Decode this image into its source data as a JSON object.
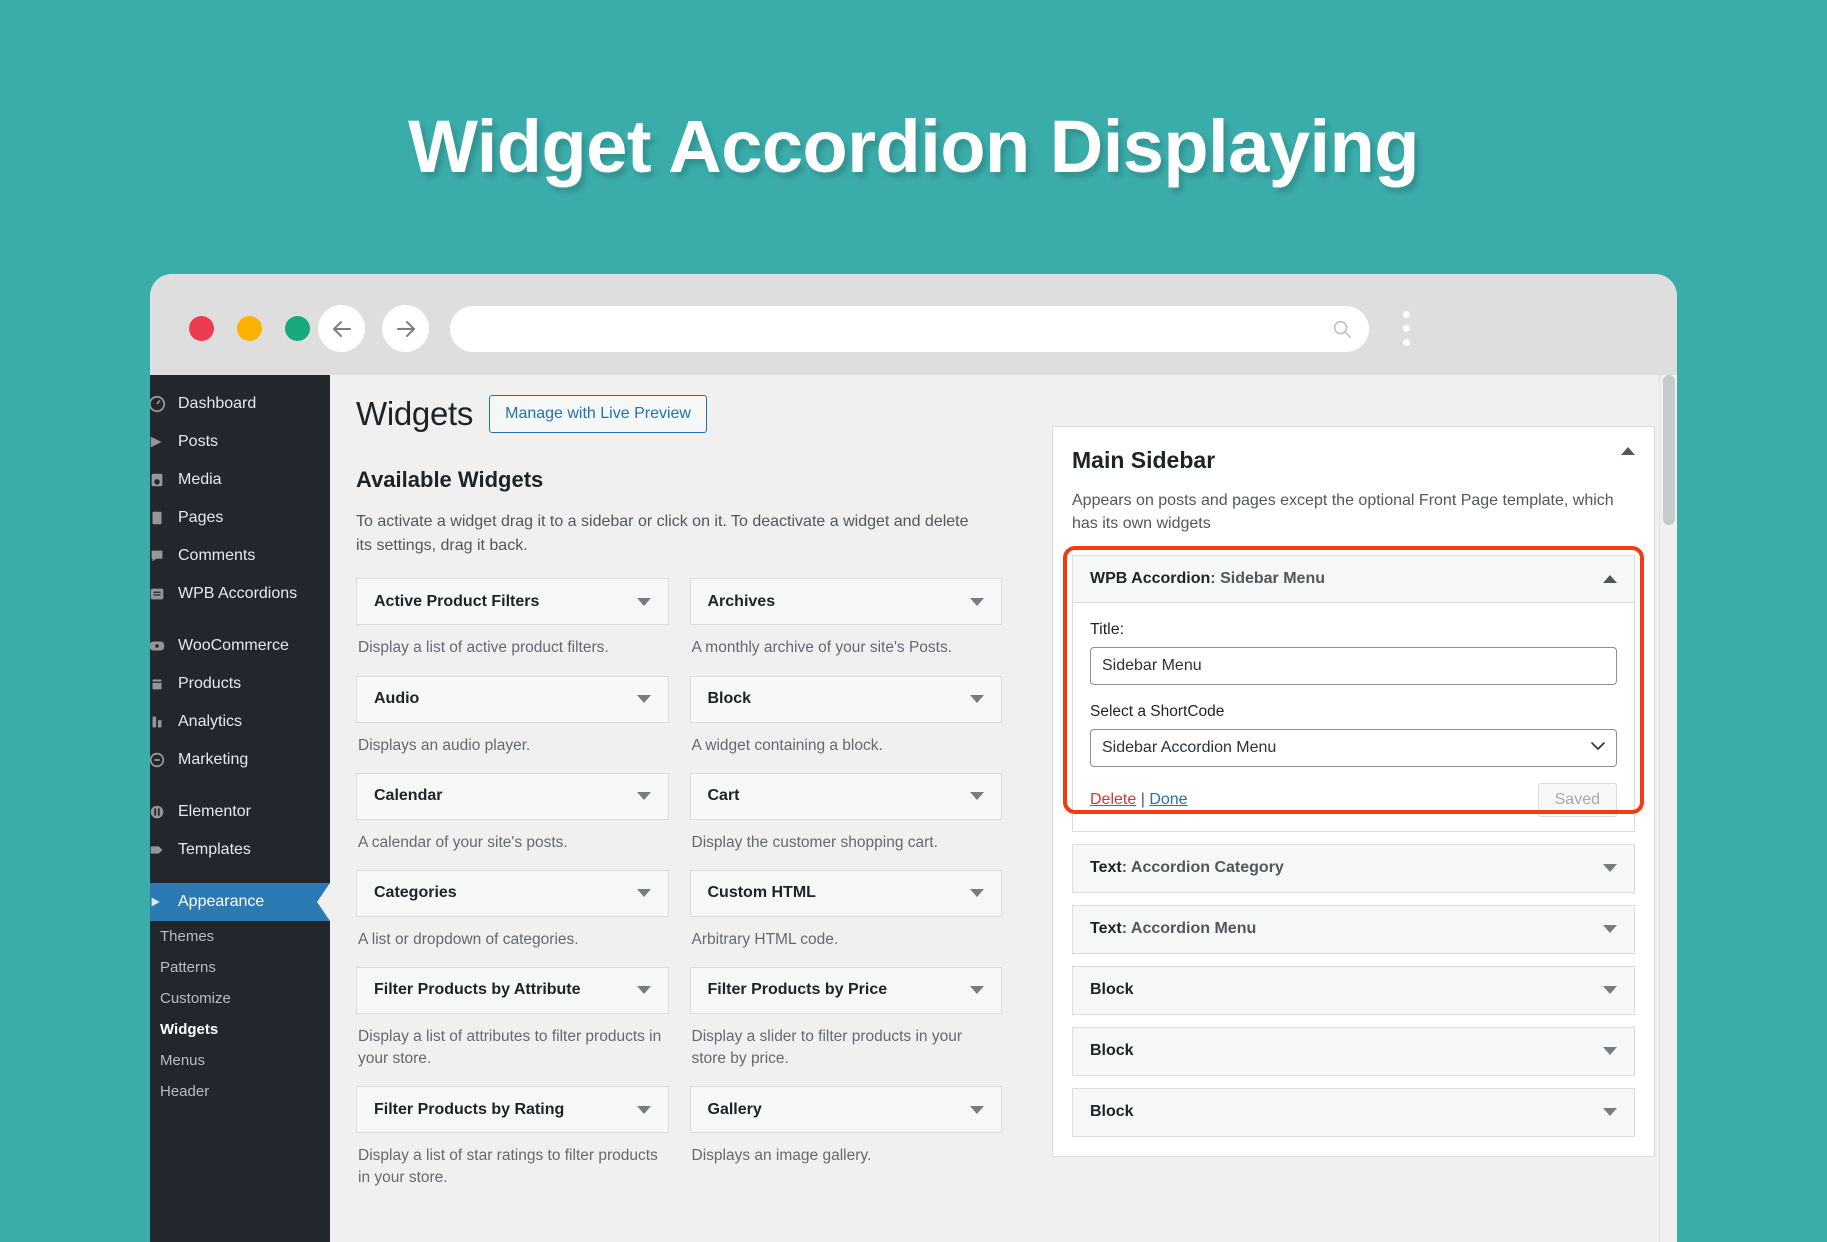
{
  "hero": {
    "title": "Widget Accordion Displaying"
  },
  "theme": {
    "background": "#3aadab",
    "accent_blue": "#2271b1",
    "highlight_red": "#f23a13",
    "admin_dark": "#22272e"
  },
  "browser": {
    "url_value": "",
    "url_placeholder": "",
    "traffic_lights": [
      "close",
      "minimize",
      "maximize"
    ],
    "back_icon": "arrow-left-icon",
    "forward_icon": "arrow-right-icon",
    "search_icon": "search-icon",
    "menu_icon": "kebab-menu-icon"
  },
  "admin_sidebar": {
    "items": [
      {
        "label": "Dashboard",
        "icon": "dashboard-icon"
      },
      {
        "label": "Posts",
        "icon": "posts-icon"
      },
      {
        "label": "Media",
        "icon": "media-icon"
      },
      {
        "label": "Pages",
        "icon": "pages-icon"
      },
      {
        "label": "Comments",
        "icon": "comments-icon"
      },
      {
        "label": "WPB Accordions",
        "icon": "accordion-icon"
      },
      {
        "label": "WooCommerce",
        "icon": "woocommerce-icon"
      },
      {
        "label": "Products",
        "icon": "products-icon"
      },
      {
        "label": "Analytics",
        "icon": "analytics-icon"
      },
      {
        "label": "Marketing",
        "icon": "marketing-icon"
      },
      {
        "label": "Elementor",
        "icon": "elementor-icon"
      },
      {
        "label": "Templates",
        "icon": "templates-icon"
      },
      {
        "label": "Appearance",
        "icon": "appearance-icon",
        "active": true
      }
    ],
    "submenu": [
      {
        "label": "Themes"
      },
      {
        "label": "Patterns"
      },
      {
        "label": "Customize"
      },
      {
        "label": "Widgets",
        "current": true
      },
      {
        "label": "Menus"
      },
      {
        "label": "Header"
      }
    ]
  },
  "page": {
    "title": "Widgets",
    "live_preview_button": "Manage with Live Preview",
    "available_heading": "Available Widgets",
    "available_description": "To activate a widget drag it to a sidebar or click on it. To deactivate a widget and delete its settings, drag it back."
  },
  "available_widgets": [
    {
      "name": "Active Product Filters",
      "description": "Display a list of active product filters."
    },
    {
      "name": "Archives",
      "description": "A monthly archive of your site's Posts."
    },
    {
      "name": "Audio",
      "description": "Displays an audio player."
    },
    {
      "name": "Block",
      "description": "A widget containing a block."
    },
    {
      "name": "Calendar",
      "description": "A calendar of your site's posts."
    },
    {
      "name": "Cart",
      "description": "Display the customer shopping cart."
    },
    {
      "name": "Categories",
      "description": "A list or dropdown of categories."
    },
    {
      "name": "Custom HTML",
      "description": "Arbitrary HTML code."
    },
    {
      "name": "Filter Products by Attribute",
      "description": "Display a list of attributes to filter products in your store."
    },
    {
      "name": "Filter Products by Price",
      "description": "Display a slider to filter products in your store by price."
    },
    {
      "name": "Filter Products by Rating",
      "description": "Display a list of star ratings to filter products in your store."
    },
    {
      "name": "Gallery",
      "description": "Displays an image gallery."
    }
  ],
  "main_sidebar": {
    "title": "Main Sidebar",
    "description": "Appears on posts and pages except the optional Front Page template, which has its own widgets",
    "collapse_icon": "chevron-up-icon",
    "open_widget": {
      "type_label": "WPB Accordion",
      "separator": ": ",
      "instance_label": "Sidebar Menu",
      "collapse_icon": "chevron-up-icon",
      "title_field_label": "Title:",
      "title_field_value": "Sidebar Menu",
      "shortcode_field_label": "Select a ShortCode",
      "shortcode_selected": "Sidebar Accordion Menu",
      "shortcode_options": [
        "Sidebar Accordion Menu"
      ],
      "delete_label": "Delete",
      "separator_pipe": "|",
      "done_label": "Done",
      "save_button_label": "Saved"
    },
    "closed_widgets": [
      {
        "type_label": "Text",
        "separator": ": ",
        "instance_label": "Accordion Category"
      },
      {
        "type_label": "Text",
        "separator": ": ",
        "instance_label": "Accordion Menu"
      },
      {
        "type_label": "Block",
        "separator": "",
        "instance_label": ""
      },
      {
        "type_label": "Block",
        "separator": "",
        "instance_label": ""
      },
      {
        "type_label": "Block",
        "separator": "",
        "instance_label": ""
      }
    ]
  }
}
